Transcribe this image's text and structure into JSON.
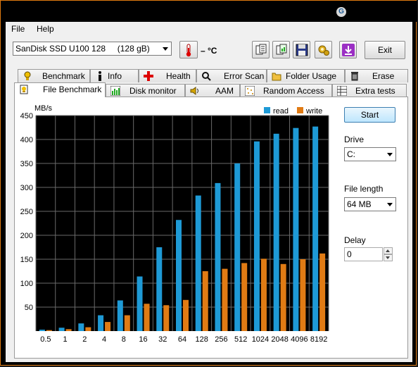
{
  "menu": {
    "file": "File",
    "help": "Help"
  },
  "toolbar": {
    "drive_select": "SanDisk SSD U100 128     (128 gB)",
    "temperature": "– °C",
    "exit_label": "Exit",
    "icons": [
      "copy-text-icon",
      "copy-image-icon",
      "save-icon",
      "options-icon",
      "download-icon"
    ]
  },
  "tabs_top": [
    {
      "label": "Benchmark",
      "icon": "benchmark-icon"
    },
    {
      "label": "Info",
      "icon": "info-icon"
    },
    {
      "label": "Health",
      "icon": "health-icon"
    },
    {
      "label": "Error Scan",
      "icon": "error-scan-icon"
    },
    {
      "label": "Folder Usage",
      "icon": "folder-icon"
    },
    {
      "label": "Erase",
      "icon": "trash-icon"
    }
  ],
  "tabs_bottom": [
    {
      "label": "File Benchmark",
      "icon": "file-benchmark-icon",
      "active": true
    },
    {
      "label": "Disk monitor",
      "icon": "disk-monitor-icon"
    },
    {
      "label": "AAM",
      "icon": "speaker-icon"
    },
    {
      "label": "Random Access",
      "icon": "random-access-icon"
    },
    {
      "label": "Extra tests",
      "icon": "extra-tests-icon"
    }
  ],
  "side": {
    "start_label": "Start",
    "drive_label": "Drive",
    "drive_value": "C:",
    "file_length_label": "File length",
    "file_length_value": "64 MB",
    "delay_label": "Delay",
    "delay_value": "0"
  },
  "colors": {
    "read": "#1e9ad6",
    "write": "#e07b14",
    "plot_bg": "#000000",
    "grid": "#6a6a6a"
  },
  "chart_data": {
    "type": "bar",
    "ylabel": "MB/s",
    "ylim": [
      0,
      450
    ],
    "yticks": [
      "50",
      "100",
      "150",
      "200",
      "250",
      "300",
      "350",
      "400",
      "450"
    ],
    "categories": [
      "0.5",
      "1",
      "2",
      "4",
      "8",
      "16",
      "32",
      "64",
      "128",
      "256",
      "512",
      "1024",
      "2048",
      "4096",
      "8192"
    ],
    "series": [
      {
        "name": "read",
        "values": [
          3,
          7,
          16,
          33,
          64,
          114,
          175,
          232,
          283,
          309,
          350,
          396,
          412,
          424,
          427
        ]
      },
      {
        "name": "write",
        "values": [
          2,
          4,
          8,
          19,
          33,
          57,
          54,
          65,
          125,
          130,
          142,
          151,
          140,
          150,
          162
        ]
      }
    ],
    "legend": "top-right",
    "grid": true
  }
}
